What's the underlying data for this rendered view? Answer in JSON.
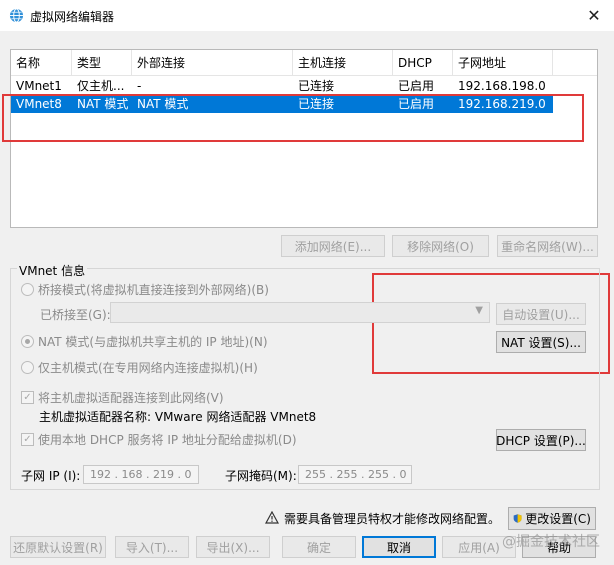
{
  "window": {
    "title": "虚拟网络编辑器",
    "close_glyph": "✕"
  },
  "list": {
    "columns": [
      "名称",
      "类型",
      "外部连接",
      "主机连接",
      "DHCP",
      "子网地址"
    ],
    "rows": [
      {
        "name": "VMnet1",
        "type": "仅主机...",
        "external": "-",
        "host": "已连接",
        "dhcp": "已启用",
        "subnet": "192.168.198.0",
        "selected": false
      },
      {
        "name": "VMnet8",
        "type": "NAT 模式",
        "external": "NAT 模式",
        "host": "已连接",
        "dhcp": "已启用",
        "subnet": "192.168.219.0",
        "selected": true
      }
    ]
  },
  "network_buttons": {
    "add": "添加网络(E)...",
    "remove": "移除网络(O)",
    "rename": "重命名网络(W)..."
  },
  "vmnet_info": {
    "group_label": "VMnet 信息",
    "bridged_label": "桥接模式(将虚拟机直接连接到外部网络)(B)",
    "bridged_to_label": "已桥接至(G):",
    "auto_settings": "自动设置(U)...",
    "nat_label": "NAT 模式(与虚拟机共享主机的 IP 地址)(N)",
    "nat_settings": "NAT 设置(S)...",
    "host_only_label": "仅主机模式(在专用网络内连接虚拟机)(H)",
    "connect_adapter_label": "将主机虚拟适配器连接到此网络(V)",
    "adapter_name": "主机虚拟适配器名称: VMware 网络适配器 VMnet8",
    "use_dhcp_label": "使用本地 DHCP 服务将 IP 地址分配给虚拟机(D)",
    "dhcp_settings": "DHCP 设置(P)...",
    "subnet_ip_label": "子网 IP (I):",
    "subnet_ip_value": "192 . 168 . 219 .  0",
    "subnet_mask_label": "子网掩码(M):",
    "subnet_mask_value": "255 . 255 . 255 .  0"
  },
  "admin_notice": {
    "text": "需要具备管理员特权才能修改网络配置。",
    "change_settings": "更改设置(C)"
  },
  "footer": {
    "restore": "还原默认设置(R)",
    "import": "导入(T)...",
    "export": "导出(X)...",
    "ok": "确定",
    "cancel": "取消",
    "apply": "应用(A)",
    "help": "帮助"
  },
  "watermark": "@掘金技术社区",
  "colors": {
    "selection": "#0078d7",
    "annotation_box": "#e03a3a"
  }
}
